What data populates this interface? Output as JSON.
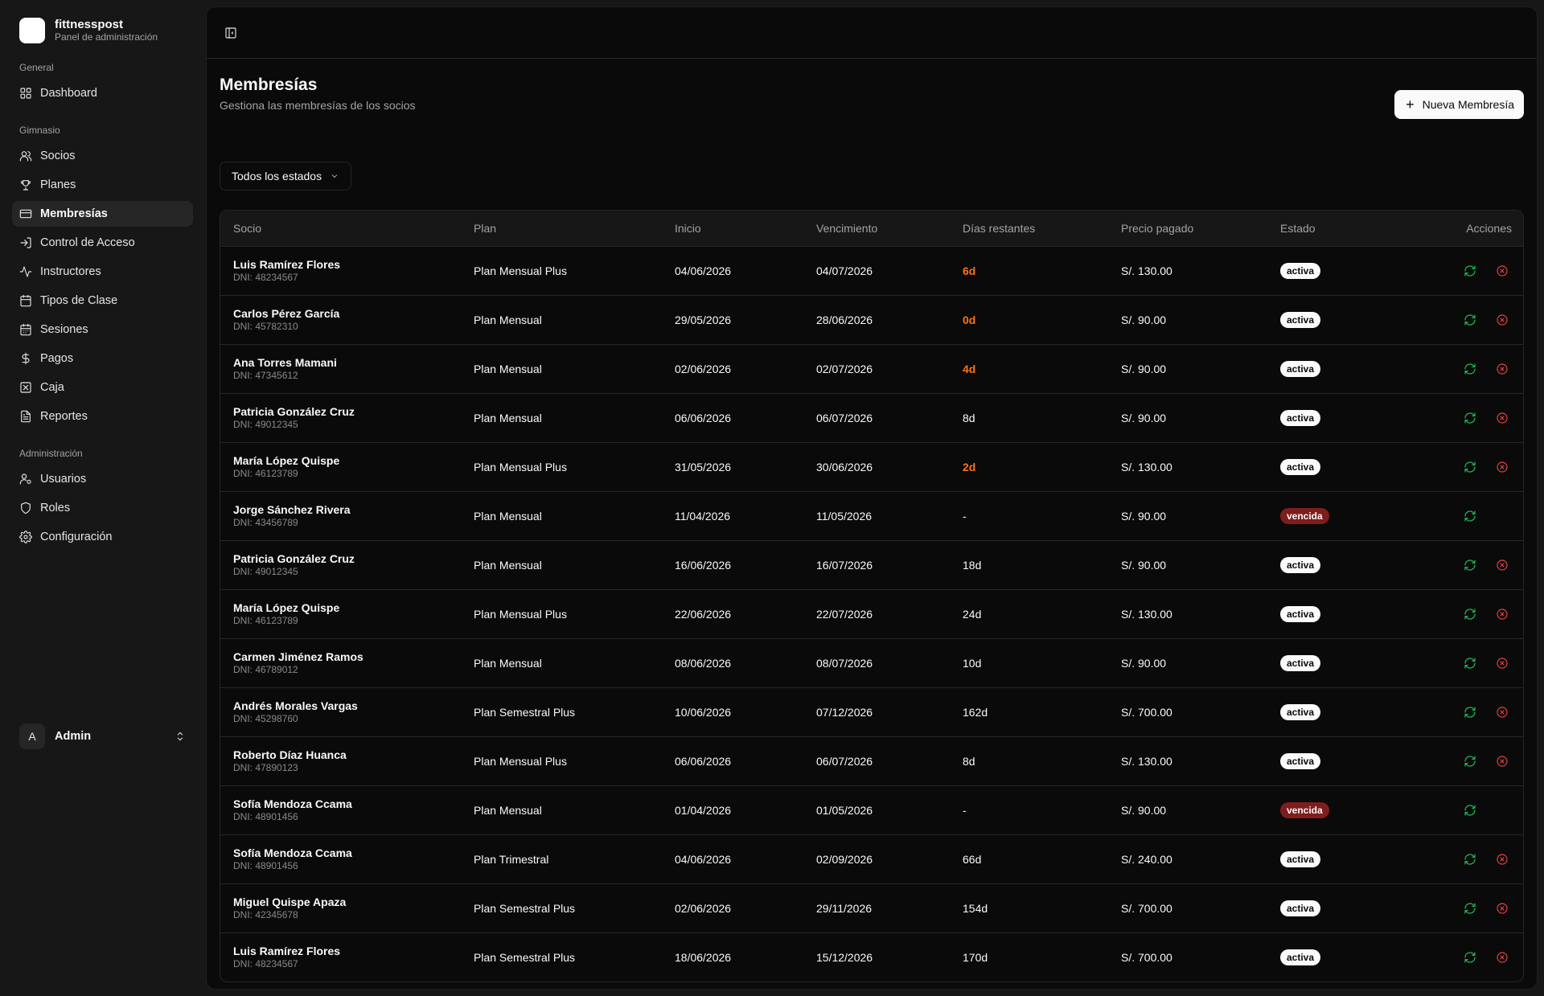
{
  "brand": {
    "name": "fittnesspost",
    "subtitle": "Panel de administración"
  },
  "sidebar": {
    "sections": [
      {
        "title": "General",
        "items": [
          {
            "label": "Dashboard",
            "icon": "dashboard-icon"
          }
        ]
      },
      {
        "title": "Gimnasio",
        "items": [
          {
            "label": "Socios",
            "icon": "users-icon"
          },
          {
            "label": "Planes",
            "icon": "trophy-icon"
          },
          {
            "label": "Membresías",
            "icon": "card-icon",
            "active": true
          },
          {
            "label": "Control de Acceso",
            "icon": "login-icon"
          },
          {
            "label": "Instructores",
            "icon": "activity-icon"
          },
          {
            "label": "Tipos de Clase",
            "icon": "calendar-icon"
          },
          {
            "label": "Sesiones",
            "icon": "calendar-days-icon"
          },
          {
            "label": "Pagos",
            "icon": "dollar-icon"
          },
          {
            "label": "Caja",
            "icon": "cash-register-icon"
          },
          {
            "label": "Reportes",
            "icon": "file-text-icon"
          }
        ]
      },
      {
        "title": "Administración",
        "items": [
          {
            "label": "Usuarios",
            "icon": "user-cog-icon"
          },
          {
            "label": "Roles",
            "icon": "shield-icon"
          },
          {
            "label": "Configuración",
            "icon": "gear-icon"
          }
        ]
      }
    ],
    "user": {
      "initial": "A",
      "name": "Admin"
    }
  },
  "page": {
    "title": "Membresías",
    "subtitle": "Gestiona las membresías de los socios",
    "new_button": "Nueva Membresía",
    "filter": "Todos los estados"
  },
  "table": {
    "columns": [
      "Socio",
      "Plan",
      "Inicio",
      "Vencimiento",
      "Días restantes",
      "Precio pagado",
      "Estado",
      "Acciones"
    ],
    "rows": [
      {
        "name": "Luis Ramírez Flores",
        "dni": "DNI: 48234567",
        "plan": "Plan Mensual Plus",
        "inicio": "04/06/2026",
        "venc": "04/07/2026",
        "dias": "6d",
        "warn": true,
        "precio": "S/. 130.00",
        "estado": "activa"
      },
      {
        "name": "Carlos Pérez García",
        "dni": "DNI: 45782310",
        "plan": "Plan Mensual",
        "inicio": "29/05/2026",
        "venc": "28/06/2026",
        "dias": "0d",
        "warn": true,
        "precio": "S/. 90.00",
        "estado": "activa"
      },
      {
        "name": "Ana Torres Mamani",
        "dni": "DNI: 47345612",
        "plan": "Plan Mensual",
        "inicio": "02/06/2026",
        "venc": "02/07/2026",
        "dias": "4d",
        "warn": true,
        "precio": "S/. 90.00",
        "estado": "activa"
      },
      {
        "name": "Patricia González Cruz",
        "dni": "DNI: 49012345",
        "plan": "Plan Mensual",
        "inicio": "06/06/2026",
        "venc": "06/07/2026",
        "dias": "8d",
        "warn": false,
        "precio": "S/. 90.00",
        "estado": "activa"
      },
      {
        "name": "María López Quispe",
        "dni": "DNI: 46123789",
        "plan": "Plan Mensual Plus",
        "inicio": "31/05/2026",
        "venc": "30/06/2026",
        "dias": "2d",
        "warn": true,
        "precio": "S/. 130.00",
        "estado": "activa"
      },
      {
        "name": "Jorge Sánchez Rivera",
        "dni": "DNI: 43456789",
        "plan": "Plan Mensual",
        "inicio": "11/04/2026",
        "venc": "11/05/2026",
        "dias": "-",
        "warn": false,
        "precio": "S/. 90.00",
        "estado": "vencida"
      },
      {
        "name": "Patricia González Cruz",
        "dni": "DNI: 49012345",
        "plan": "Plan Mensual",
        "inicio": "16/06/2026",
        "venc": "16/07/2026",
        "dias": "18d",
        "warn": false,
        "precio": "S/. 90.00",
        "estado": "activa"
      },
      {
        "name": "María López Quispe",
        "dni": "DNI: 46123789",
        "plan": "Plan Mensual Plus",
        "inicio": "22/06/2026",
        "venc": "22/07/2026",
        "dias": "24d",
        "warn": false,
        "precio": "S/. 130.00",
        "estado": "activa"
      },
      {
        "name": "Carmen Jiménez Ramos",
        "dni": "DNI: 46789012",
        "plan": "Plan Mensual",
        "inicio": "08/06/2026",
        "venc": "08/07/2026",
        "dias": "10d",
        "warn": false,
        "precio": "S/. 90.00",
        "estado": "activa"
      },
      {
        "name": "Andrés Morales Vargas",
        "dni": "DNI: 45298760",
        "plan": "Plan Semestral Plus",
        "inicio": "10/06/2026",
        "venc": "07/12/2026",
        "dias": "162d",
        "warn": false,
        "precio": "S/. 700.00",
        "estado": "activa"
      },
      {
        "name": "Roberto Díaz Huanca",
        "dni": "DNI: 47890123",
        "plan": "Plan Mensual Plus",
        "inicio": "06/06/2026",
        "venc": "06/07/2026",
        "dias": "8d",
        "warn": false,
        "precio": "S/. 130.00",
        "estado": "activa"
      },
      {
        "name": "Sofía Mendoza Ccama",
        "dni": "DNI: 48901456",
        "plan": "Plan Mensual",
        "inicio": "01/04/2026",
        "venc": "01/05/2026",
        "dias": "-",
        "warn": false,
        "precio": "S/. 90.00",
        "estado": "vencida"
      },
      {
        "name": "Sofía Mendoza Ccama",
        "dni": "DNI: 48901456",
        "plan": "Plan Trimestral",
        "inicio": "04/06/2026",
        "venc": "02/09/2026",
        "dias": "66d",
        "warn": false,
        "precio": "S/. 240.00",
        "estado": "activa"
      },
      {
        "name": "Miguel Quispe Apaza",
        "dni": "DNI: 42345678",
        "plan": "Plan Semestral Plus",
        "inicio": "02/06/2026",
        "venc": "29/11/2026",
        "dias": "154d",
        "warn": false,
        "precio": "S/. 700.00",
        "estado": "activa"
      },
      {
        "name": "Luis Ramírez Flores",
        "dni": "DNI: 48234567",
        "plan": "Plan Semestral Plus",
        "inicio": "18/06/2026",
        "venc": "15/12/2026",
        "dias": "170d",
        "warn": false,
        "precio": "S/. 700.00",
        "estado": "activa"
      }
    ]
  },
  "colors": {
    "warn": "#f97316",
    "renew": "#22c55e",
    "cancel": "#ef4444",
    "vencida_bg": "#7f1d1d"
  }
}
